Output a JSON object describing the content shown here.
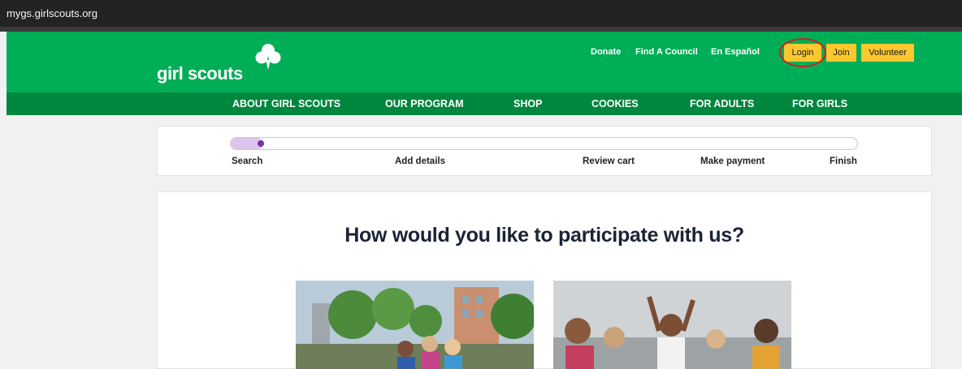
{
  "browser": {
    "url": "mygs.girlscouts.org"
  },
  "header": {
    "logo_text": "girl scouts",
    "utility_links": [
      "Donate",
      "Find A Council",
      "En Español"
    ],
    "buttons": {
      "login": "Login",
      "join": "Join",
      "volunteer": "Volunteer"
    }
  },
  "nav": {
    "items": [
      "ABOUT GIRL SCOUTS",
      "OUR PROGRAM",
      "SHOP",
      "COOKIES",
      "FOR ADULTS",
      "FOR GIRLS"
    ]
  },
  "progress": {
    "steps": [
      "Search",
      "Add details",
      "Review cart",
      "Make payment",
      "Finish"
    ],
    "current_step": 1
  },
  "main": {
    "heading": "How would you like to participate with us?"
  },
  "colors": {
    "brand_green": "#00ae58",
    "nav_green": "#00873f",
    "button_yellow": "#fdc72f",
    "progress_purple": "#7b2fa8",
    "highlight_red": "#d0211c"
  }
}
